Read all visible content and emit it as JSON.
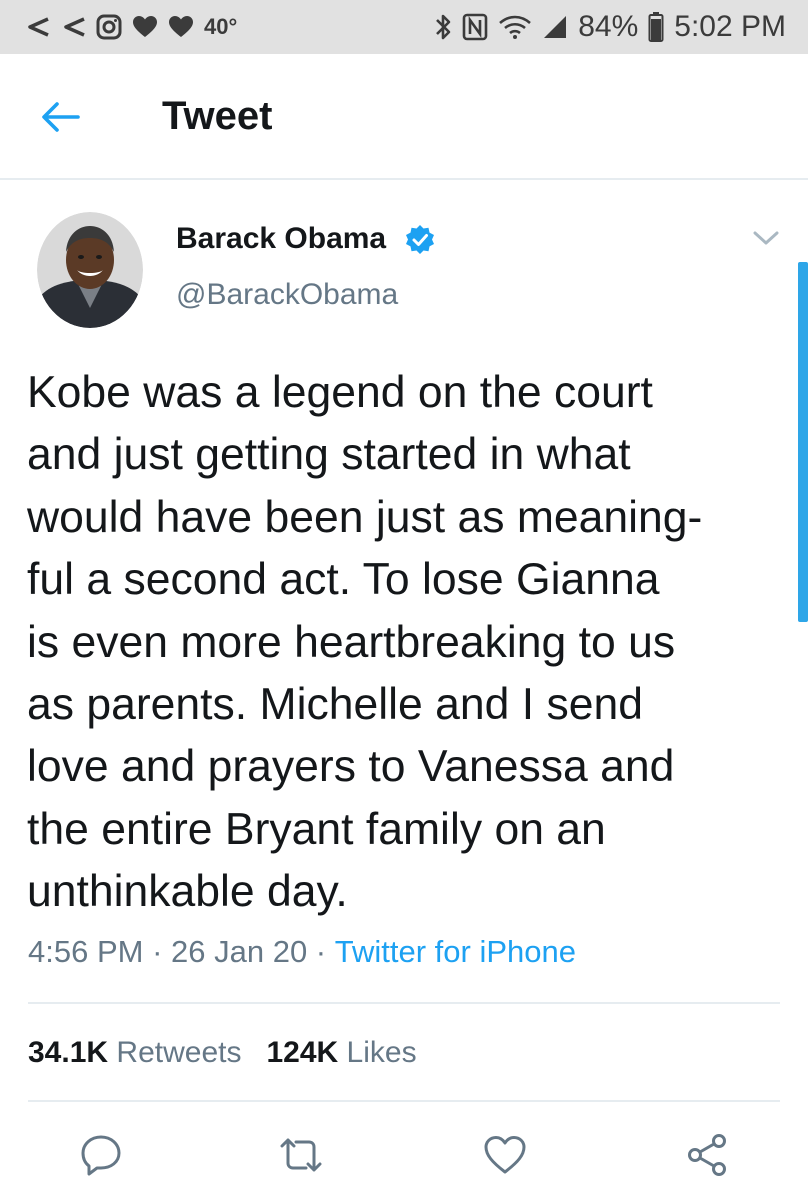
{
  "status_bar": {
    "temperature": "40°",
    "battery": "84%",
    "time": "5:02 PM",
    "left_icons": [
      "back-arrow-icon",
      "back-arrow-icon",
      "instagram-icon",
      "heart-icon",
      "heart-icon"
    ],
    "right_icons": [
      "bluetooth-icon",
      "nfc-icon",
      "wifi-icon",
      "signal-icon",
      "battery-icon"
    ]
  },
  "header": {
    "title": "Tweet",
    "back_icon": "back-arrow-icon"
  },
  "tweet": {
    "author_name": "Barack Obama",
    "handle": "@BarackObama",
    "verified": true,
    "text": "Kobe was a legend on the court\nand just getting started in what\nwould have been just as meaning-\nful a second act. To lose Gianna\nis even more heartbreaking to us\nas parents. Michelle and I send\nlove and prayers to Vanessa and\nthe entire Bryant family on an\nunthinkable day.",
    "time": "4:56 PM",
    "date": "26 Jan 20",
    "separator": " · ",
    "source": "Twitter for iPhone"
  },
  "stats": {
    "retweets_count": "34.1K",
    "retweets_label": "Retweets",
    "likes_count": "124K",
    "likes_label": "Likes"
  },
  "actions": [
    "reply-icon",
    "retweet-icon",
    "like-icon",
    "share-icon"
  ],
  "colors": {
    "accent": "#1da1f2",
    "text_primary": "#14171a",
    "text_secondary": "#657786",
    "status_bar_bg": "#e1e1e1"
  }
}
